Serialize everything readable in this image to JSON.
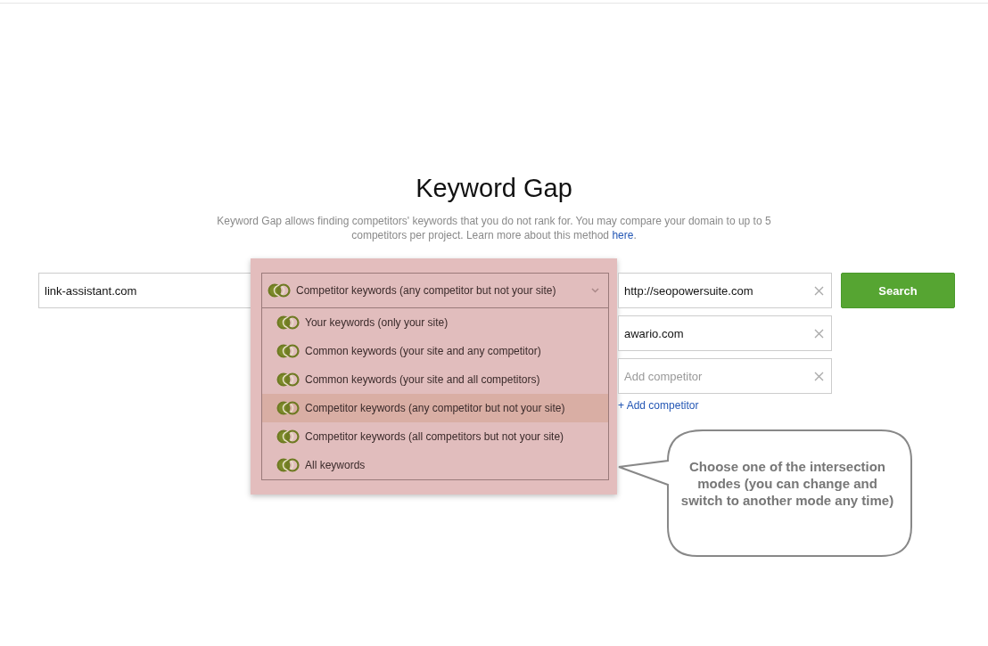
{
  "title": "Keyword Gap",
  "intro": {
    "text": "Keyword Gap allows finding competitors' keywords that you do not rank for. You may compare your domain to up to 5 competitors per project. Learn more about this method",
    "link": "here",
    "after": "."
  },
  "domain": {
    "value": "link-assistant.com"
  },
  "mode_dropdown": {
    "value": "Competitor keywords (any competitor but not your site)",
    "expanded": true,
    "options": [
      {
        "label": "Your keywords (only your site)",
        "selected": false
      },
      {
        "label": "Common keywords (your site and any competitor)",
        "selected": false
      },
      {
        "label": "Common keywords (your site and all competitors)",
        "selected": false
      },
      {
        "label": "Competitor keywords (any competitor but not your site)",
        "selected": true
      },
      {
        "label": "Competitor keywords (all competitors but not your site)",
        "selected": false
      },
      {
        "label": "All keywords",
        "selected": false
      }
    ]
  },
  "competitors": [
    {
      "value": "http://seopowersuite.com"
    },
    {
      "value": "awario.com"
    },
    {
      "placeholder": "Add competitor"
    }
  ],
  "add_competitor": "+ Add competitor",
  "search_button": "Search",
  "callout": "Choose one of the intersection modes (you can change and switch to another mode any time)"
}
